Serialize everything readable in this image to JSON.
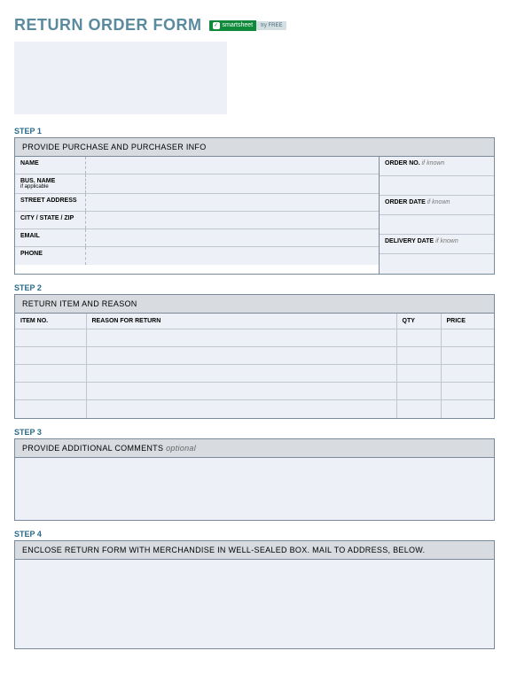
{
  "title": "RETURN ORDER FORM",
  "badge": {
    "left": "smartsheet",
    "right": "try FREE"
  },
  "step1": {
    "label": "STEP 1",
    "header": "PROVIDE PURCHASE AND PURCHASER INFO",
    "fields": {
      "name": "NAME",
      "busName": "BUS. NAME",
      "busNameSub": "if applicable",
      "street": "STREET ADDRESS",
      "csz": "CITY / STATE / ZIP",
      "email": "EMAIL",
      "phone": "PHONE",
      "orderNo": "ORDER NO.",
      "orderDate": "ORDER DATE",
      "deliveryDate": "DELIVERY DATE",
      "hint": "if known"
    }
  },
  "step2": {
    "label": "STEP 2",
    "header": "RETURN ITEM AND REASON",
    "cols": {
      "item": "ITEM NO.",
      "reason": "REASON FOR RETURN",
      "qty": "QTY",
      "price": "PRICE"
    }
  },
  "step3": {
    "label": "STEP 3",
    "header": "PROVIDE ADDITIONAL COMMENTS",
    "headerHint": "optional"
  },
  "step4": {
    "label": "STEP 4",
    "header": "ENCLOSE RETURN FORM WITH MERCHANDISE IN WELL-SEALED BOX.  MAIL TO ADDRESS, BELOW."
  }
}
